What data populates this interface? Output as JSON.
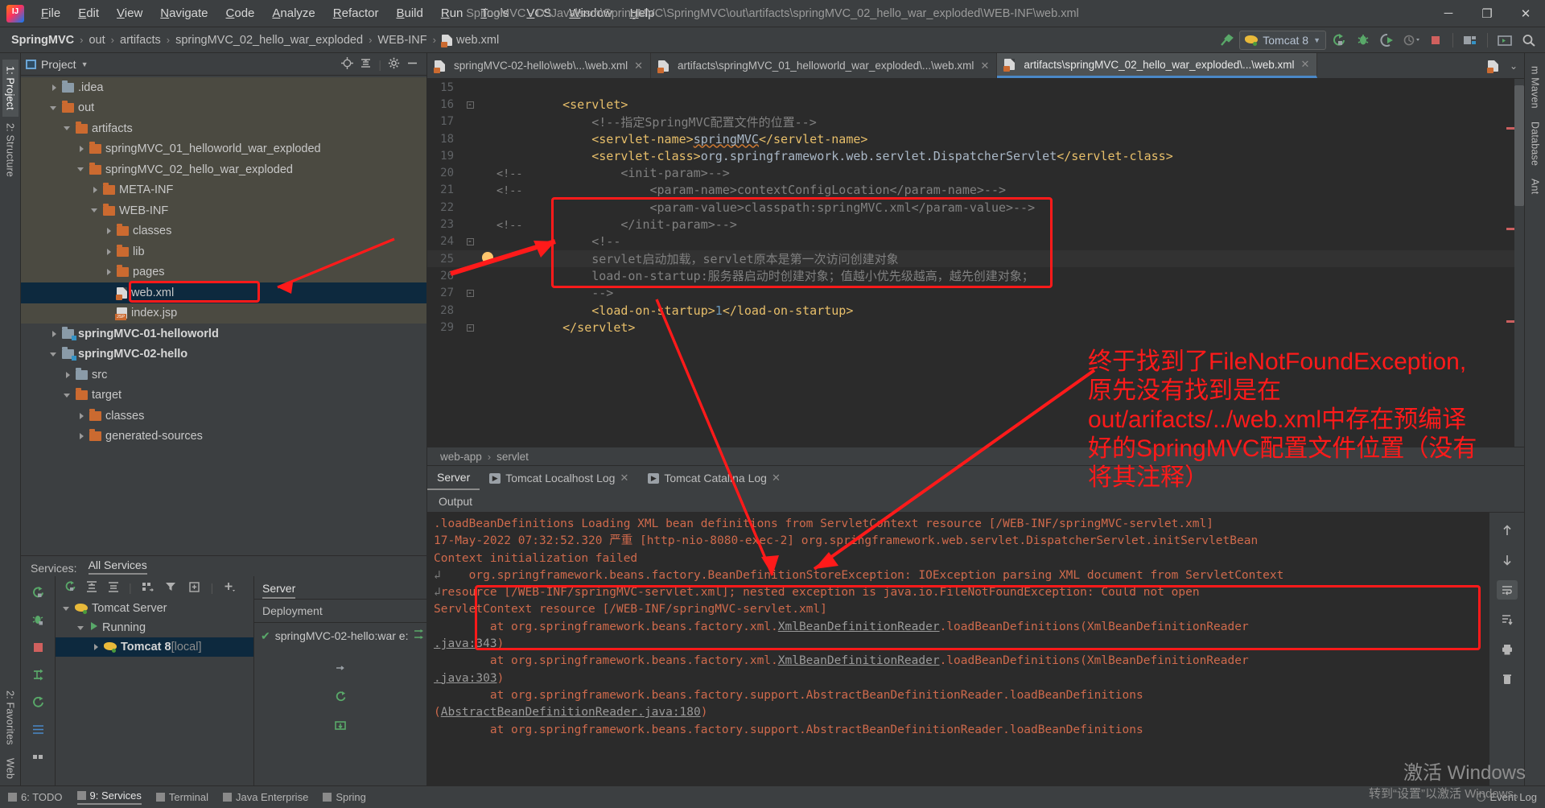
{
  "window": {
    "title": "SpringMVC - D:\\Java\\ssm\\SpringMVC\\SpringMVC\\out\\artifacts\\springMVC_02_hello_war_exploded\\WEB-INF\\web.xml",
    "minimize": "─",
    "maximize": "❐",
    "close": "✕"
  },
  "menubar": {
    "items": [
      "File",
      "Edit",
      "View",
      "Navigate",
      "Code",
      "Analyze",
      "Refactor",
      "Build",
      "Run",
      "Tools",
      "VCS",
      "Window",
      "Help"
    ]
  },
  "breadcrumb": {
    "items": [
      "SpringMVC",
      "out",
      "artifacts",
      "springMVC_02_hello_war_exploded",
      "WEB-INF",
      "web.xml"
    ],
    "separator": "›"
  },
  "toolbar": {
    "build_icon": "hammer-icon",
    "run_config": "Tomcat 8",
    "dropdown_caret": "▼",
    "icons": [
      "run-icon",
      "debug-icon",
      "run-coverage-icon",
      "profile-icon",
      "stop-icon",
      "project-structure-icon",
      "terminal-icon",
      "search-everywhere-icon"
    ]
  },
  "left_strip": {
    "tabs": [
      "1: Project",
      "2: Structure",
      "2: Favorites",
      "Web"
    ]
  },
  "right_strip": {
    "tabs": [
      "m Maven",
      "Database",
      "Ant"
    ]
  },
  "project_panel": {
    "title": "Project",
    "caret": "▼",
    "tools": [
      "locate-icon",
      "collapse-all-icon",
      "settings-icon",
      "hide-icon"
    ],
    "tree": [
      {
        "label": ".idea",
        "indent": 1,
        "arrow": "right",
        "icon": "folder-grey",
        "style": "shade"
      },
      {
        "label": "out",
        "indent": 1,
        "arrow": "down",
        "icon": "folder-orange",
        "style": "shade"
      },
      {
        "label": "artifacts",
        "indent": 2,
        "arrow": "down",
        "icon": "folder-orange",
        "style": "shade"
      },
      {
        "label": "springMVC_01_helloworld_war_exploded",
        "indent": 3,
        "arrow": "right",
        "icon": "folder-orange",
        "style": "shade"
      },
      {
        "label": "springMVC_02_hello_war_exploded",
        "indent": 3,
        "arrow": "down",
        "icon": "folder-orange",
        "style": "shade"
      },
      {
        "label": "META-INF",
        "indent": 4,
        "arrow": "right",
        "icon": "folder-orange",
        "style": "shade"
      },
      {
        "label": "WEB-INF",
        "indent": 4,
        "arrow": "down",
        "icon": "folder-orange",
        "style": "shade"
      },
      {
        "label": "classes",
        "indent": 5,
        "arrow": "right",
        "icon": "folder-orange",
        "style": "shade"
      },
      {
        "label": "lib",
        "indent": 5,
        "arrow": "right",
        "icon": "folder-orange",
        "style": "shade"
      },
      {
        "label": "pages",
        "indent": 5,
        "arrow": "right",
        "icon": "folder-orange",
        "style": "shade"
      },
      {
        "label": "web.xml",
        "indent": 5,
        "arrow": "none",
        "icon": "xml-file",
        "style": "selected"
      },
      {
        "label": "index.jsp",
        "indent": 5,
        "arrow": "none",
        "icon": "jsp-file",
        "style": "shade"
      },
      {
        "label": "springMVC-01-helloworld",
        "indent": 1,
        "arrow": "right",
        "icon": "module-grey",
        "style": "bold"
      },
      {
        "label": "springMVC-02-hello",
        "indent": 1,
        "arrow": "down",
        "icon": "module-grey",
        "style": "bold"
      },
      {
        "label": "src",
        "indent": 2,
        "arrow": "right",
        "icon": "folder-grey",
        "style": ""
      },
      {
        "label": "target",
        "indent": 2,
        "arrow": "down",
        "icon": "folder-orange",
        "style": ""
      },
      {
        "label": "classes",
        "indent": 3,
        "arrow": "right",
        "icon": "folder-orange",
        "style": ""
      },
      {
        "label": "generated-sources",
        "indent": 3,
        "arrow": "right",
        "icon": "folder-orange",
        "style": ""
      }
    ]
  },
  "services": {
    "label": "Services:",
    "active_tab": "All Services",
    "toolbar_icons": [
      "rerun-icon",
      "expand-all-icon",
      "collapse-all-icon",
      "group-icon",
      "filter-icon",
      "add-tab-icon",
      "plus-icon"
    ],
    "side_icons": [
      "rerun-icon",
      "debug-icon",
      "stop-icon",
      "redeploy-icon",
      "settings-icon",
      "layout-icon"
    ],
    "tree": [
      {
        "label": "Tomcat Server",
        "indent": 0,
        "arrow": "down",
        "icon": "tomcat-icon",
        "selected": false,
        "suffix": ""
      },
      {
        "label": "Running",
        "indent": 1,
        "arrow": "down",
        "icon": "run-green-icon",
        "selected": false,
        "suffix": ""
      },
      {
        "label": "Tomcat 8",
        "indent": 2,
        "arrow": "right",
        "icon": "tomcat-icon",
        "selected": true,
        "suffix": "[local]"
      }
    ]
  },
  "deployment": {
    "tabs": [
      "Server",
      "Tomcat Localhost Log",
      "Tomcat Catalina Log"
    ],
    "active_tab": "Server",
    "section_label": "Deployment",
    "artifact": "springMVC-02-hello:war e:",
    "artifact_status": "✔",
    "side_icons": [
      "rerun-icon",
      "redeploy-icon",
      "update-icon",
      "deploy-icon"
    ]
  },
  "editor": {
    "tabs": [
      {
        "label": "springMVC-02-hello\\web\\...\\web.xml",
        "active": false
      },
      {
        "label": "artifacts\\springMVC_01_helloworld_war_exploded\\...\\web.xml",
        "active": false
      },
      {
        "label": "artifacts\\springMVC_02_hello_war_exploded\\...\\web.xml",
        "active": true
      }
    ],
    "tab_close": "✕",
    "tail_icons": [
      "file-icon",
      "chevron-down-icon"
    ],
    "lines": [
      {
        "n": "15",
        "fold": "",
        "indent": 0,
        "text": ""
      },
      {
        "n": "16",
        "fold": "-",
        "indent": 0,
        "text": "<servlet>"
      },
      {
        "n": "17",
        "fold": "",
        "indent": 0,
        "text": ""
      },
      {
        "n": "18",
        "fold": "",
        "indent": 0,
        "text": ""
      },
      {
        "n": "19",
        "fold": "",
        "indent": 0,
        "text": ""
      },
      {
        "n": "20",
        "fold": "",
        "indent": 0,
        "text": ""
      },
      {
        "n": "21",
        "fold": "",
        "indent": 0,
        "text": ""
      },
      {
        "n": "22",
        "fold": "",
        "indent": 0,
        "text": ""
      },
      {
        "n": "23",
        "fold": "",
        "indent": 0,
        "text": ""
      },
      {
        "n": "24",
        "fold": "-",
        "indent": 0,
        "text": ""
      },
      {
        "n": "25",
        "fold": "",
        "indent": 0,
        "text": ""
      },
      {
        "n": "26",
        "fold": "",
        "indent": 0,
        "text": ""
      },
      {
        "n": "27",
        "fold": "-",
        "indent": 0,
        "text": ""
      },
      {
        "n": "28",
        "fold": "",
        "indent": 0,
        "text": ""
      },
      {
        "n": "29",
        "fold": "-",
        "indent": 0,
        "text": ""
      }
    ],
    "code": {
      "l16": "    <servlet>",
      "l17_pre": "        <!--",
      "l17_cmt": "        指定SpringMVC配置文件的位置-->",
      "l18": "        <servlet-name>springMVC</servlet-name>",
      "l19": "        <servlet-class>org.springframework.web.servlet.DispatcherServlet</servlet-class>",
      "l20_gutter": "<!--",
      "l20": "            <init-param>-->",
      "l21_gutter": "<!--",
      "l21": "                <param-name>contextConfigLocation</param-name>-->",
      "l22": "                <param-value>classpath:springMVC.xml</param-value>-->",
      "l23_gutter": "<!--",
      "l23": "            </init-param>-->",
      "l24": "        <!--",
      "l25": "        servlet启动加载，servlet原本是第一次访问创建对象",
      "l26": "        load-on-startup:服务器启动时创建对象；值越小优先级越高，越先创建对象；",
      "l27": "        -->",
      "l28_a": "        <load-on-startup>",
      "l28_n": "1",
      "l28_b": "</load-on-startup>",
      "l29": "    </servlet>"
    },
    "bulb_icon": "intention-bulb-icon",
    "status_crumb": [
      "web-app",
      "servlet"
    ],
    "status_sep": "›"
  },
  "console": {
    "output_label": "Output",
    "lines": [
      {
        "text": ".loadBeanDefinitions Loading XML bean definitions from ServletContext resource [/WEB-INF/springMVC-servlet.xml]",
        "indent": 1
      },
      {
        "text": "17-May-2022 07:32:52.320 严重 [http-nio-8080-exec-2] org.springframework.web.servlet.DispatcherServlet.initServletBean",
        "indent": 0
      },
      {
        "text": "Context initialization failed",
        "indent": 1
      },
      {
        "text": "    org.springframework.beans.factory.BeanDefinitionStoreException: IOException parsing XML document from ServletContext",
        "indent": 1,
        "wrap": "↲"
      },
      {
        "text": "resource [/WEB-INF/springMVC-servlet.xml]; nested exception is java.io.FileNotFoundException: Could not open",
        "indent": 0,
        "wrap": "↲"
      },
      {
        "text": "ServletContext resource [/WEB-INF/springMVC-servlet.xml]",
        "indent": 0
      },
      {
        "text": "        at org.springframework.beans.factory.xml.XmlBeanDefinitionReader.loadBeanDefinitions(XmlBeanDefinitionReader",
        "indent": 0,
        "link": "XmlBeanDefinitionReader"
      },
      {
        "text": ".java:343)",
        "indent": 0,
        "link": ".java:343"
      },
      {
        "text": "        at org.springframework.beans.factory.xml.XmlBeanDefinitionReader.loadBeanDefinitions(XmlBeanDefinitionReader",
        "indent": 0,
        "link": "XmlBeanDefinitionReader"
      },
      {
        "text": ".java:303)",
        "indent": 0,
        "link": ".java:303"
      },
      {
        "text": "        at org.springframework.beans.factory.support.AbstractBeanDefinitionReader.loadBeanDefinitions",
        "indent": 0
      },
      {
        "text": "(AbstractBeanDefinitionReader.java:180)",
        "indent": 0,
        "link": "AbstractBeanDefinitionReader.java:180"
      },
      {
        "text": "        at org.springframework.beans.factory.support.AbstractBeanDefinitionReader.loadBeanDefinitions",
        "indent": 0
      }
    ],
    "side_icons": [
      "scroll-up-icon",
      "scroll-down-icon",
      "soft-wrap-icon",
      "scroll-to-end-icon",
      "print-icon",
      "trash-icon"
    ]
  },
  "annotation": {
    "text_lines": [
      "终于找到了FileNotFoundException,",
      "原先没有找到是在",
      "out/arifacts/../web.xml中存在预编译",
      "好的SpringMVC配置文件位置（没有",
      "将其注释）"
    ],
    "color": "#ff1a1a"
  },
  "statusbar": {
    "items": [
      "6: TODO",
      "9: Services",
      "Terminal",
      "Java Enterprise",
      "Spring"
    ],
    "active": "9: Services",
    "right": "Event Log"
  },
  "watermark": {
    "line1": "激活 Windows",
    "line2": "转到“设置”以激活 Windows。"
  }
}
